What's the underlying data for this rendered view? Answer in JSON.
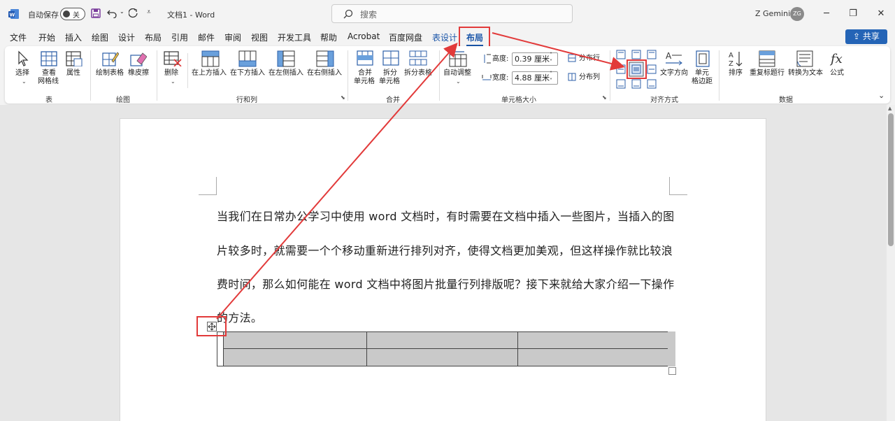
{
  "titlebar": {
    "autosave_label": "自动保存",
    "autosave_state": "关",
    "doc_title": "文档1 - Word",
    "search_placeholder": "搜索",
    "user_name": "Z Gemini",
    "user_initials": "ZG"
  },
  "menu": {
    "items": [
      "文件",
      "开始",
      "插入",
      "绘图",
      "设计",
      "布局",
      "引用",
      "邮件",
      "审阅",
      "视图",
      "开发工具",
      "帮助",
      "Acrobat",
      "百度网盘"
    ],
    "context_tab": "表设计",
    "active_tab": "布局",
    "share_label": "共享"
  },
  "ribbon": {
    "groups": {
      "table": "表",
      "draw": "绘图",
      "rows_cols": "行和列",
      "merge": "合并",
      "cell_size": "单元格大小",
      "alignment": "对齐方式",
      "data": "数据"
    },
    "buttons": {
      "select": "选择",
      "view_grid": "查看",
      "view_grid2": "网格线",
      "properties": "属性",
      "draw_table": "绘制表格",
      "eraser": "橡皮擦",
      "delete": "删除",
      "insert_above": "在上方插入",
      "insert_below": "在下方插入",
      "insert_left": "在左侧插入",
      "insert_right": "在右侧插入",
      "merge_cells": "合并",
      "merge_cells2": "单元格",
      "split_cells": "拆分",
      "split_cells2": "单元格",
      "split_table": "拆分表格",
      "autofit": "自动调整",
      "height_label": "高度:",
      "height_value": "0.39 厘米",
      "width_label": "宽度:",
      "width_value": "4.88 厘米",
      "distribute_rows": "分布行",
      "distribute_cols": "分布列",
      "text_direction": "文字方向",
      "cell_margins": "单元",
      "cell_margins2": "格边距",
      "sort": "排序",
      "repeat_header": "重复标题行",
      "convert_text": "转换为文本",
      "formula": "公式"
    }
  },
  "document": {
    "lines": [
      "当我们在日常办公学习中使用 word 文档时，有时需要在文档中插入一些图片，当插入的图",
      "片较多时，就需要一个个移动重新进行排列对齐，使得文档更加美观，但这样操作就比较浪",
      "费时间，那么如何能在 word 文档中将图片批量行列排版呢？接下来就给大家介绍一下操作",
      "的方法。"
    ]
  },
  "colors": {
    "accent": "#1a55a8",
    "highlight": "#e23a3a",
    "cell_shading": "#c9c9c9"
  }
}
